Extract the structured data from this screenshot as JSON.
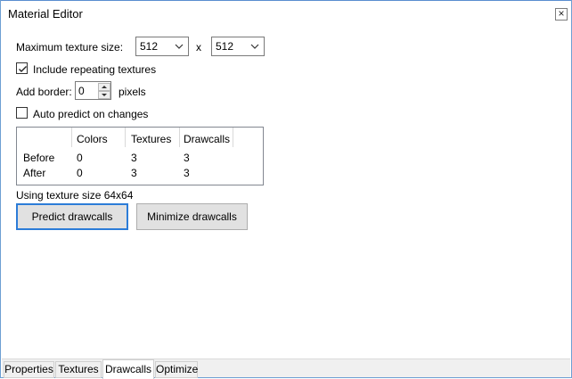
{
  "window": {
    "title": "Material Editor",
    "close_glyph": "×"
  },
  "texture": {
    "label": "Maximum texture size:",
    "width": "512",
    "separator": "x",
    "height": "512"
  },
  "repeating": {
    "label": "Include repeating textures",
    "checked": true
  },
  "border": {
    "label": "Add border:",
    "value": "0",
    "unit": "pixels"
  },
  "auto_predict": {
    "label": "Auto predict on changes",
    "checked": false
  },
  "stats": {
    "headers": [
      "",
      "Colors",
      "Textures",
      "Drawcalls"
    ],
    "rows": [
      {
        "label": "Before",
        "colors": "0",
        "textures": "3",
        "drawcalls": "3"
      },
      {
        "label": "After",
        "colors": "0",
        "textures": "3",
        "drawcalls": "3"
      }
    ]
  },
  "status": "Using texture size 64x64",
  "buttons": {
    "predict": "Predict drawcalls",
    "minimize": "Minimize drawcalls"
  },
  "tabs": [
    {
      "label": "Properties",
      "active": false
    },
    {
      "label": "Textures",
      "active": false
    },
    {
      "label": "Drawcalls",
      "active": true
    },
    {
      "label": "Optimize",
      "active": false
    }
  ],
  "colors": {
    "accent": "#2c7cd8",
    "window_border": "#6d9fd3"
  }
}
